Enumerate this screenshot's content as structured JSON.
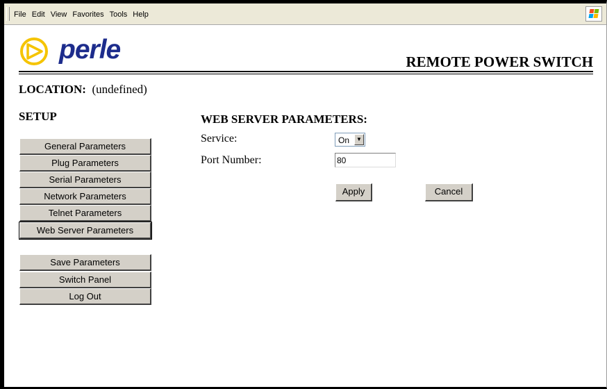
{
  "menubar": {
    "items": [
      "File",
      "Edit",
      "View",
      "Favorites",
      "Tools",
      "Help"
    ]
  },
  "header": {
    "logo_text": "perle",
    "product_title": "REMOTE POWER SWITCH"
  },
  "location": {
    "label": "LOCATION:",
    "value": "(undefined)"
  },
  "sidebar": {
    "title": "SETUP",
    "menu": [
      "General Parameters",
      "Plug Parameters",
      "Serial Parameters",
      "Network Parameters",
      "Telnet Parameters",
      "Web Server Parameters"
    ],
    "active": "Web Server Parameters",
    "actions": [
      "Save Parameters",
      "Switch Panel",
      "Log Out"
    ]
  },
  "form": {
    "title": "WEB SERVER PARAMETERS:",
    "service_label": "Service:",
    "service_value": "On",
    "port_label": "Port Number:",
    "port_value": "80",
    "apply_label": "Apply",
    "cancel_label": "Cancel"
  },
  "colors": {
    "logo_blue": "#1d2c8c",
    "logo_ring": "#f5c400",
    "button_face": "#d4d0c8",
    "menubar_bg": "#ece9d8"
  }
}
